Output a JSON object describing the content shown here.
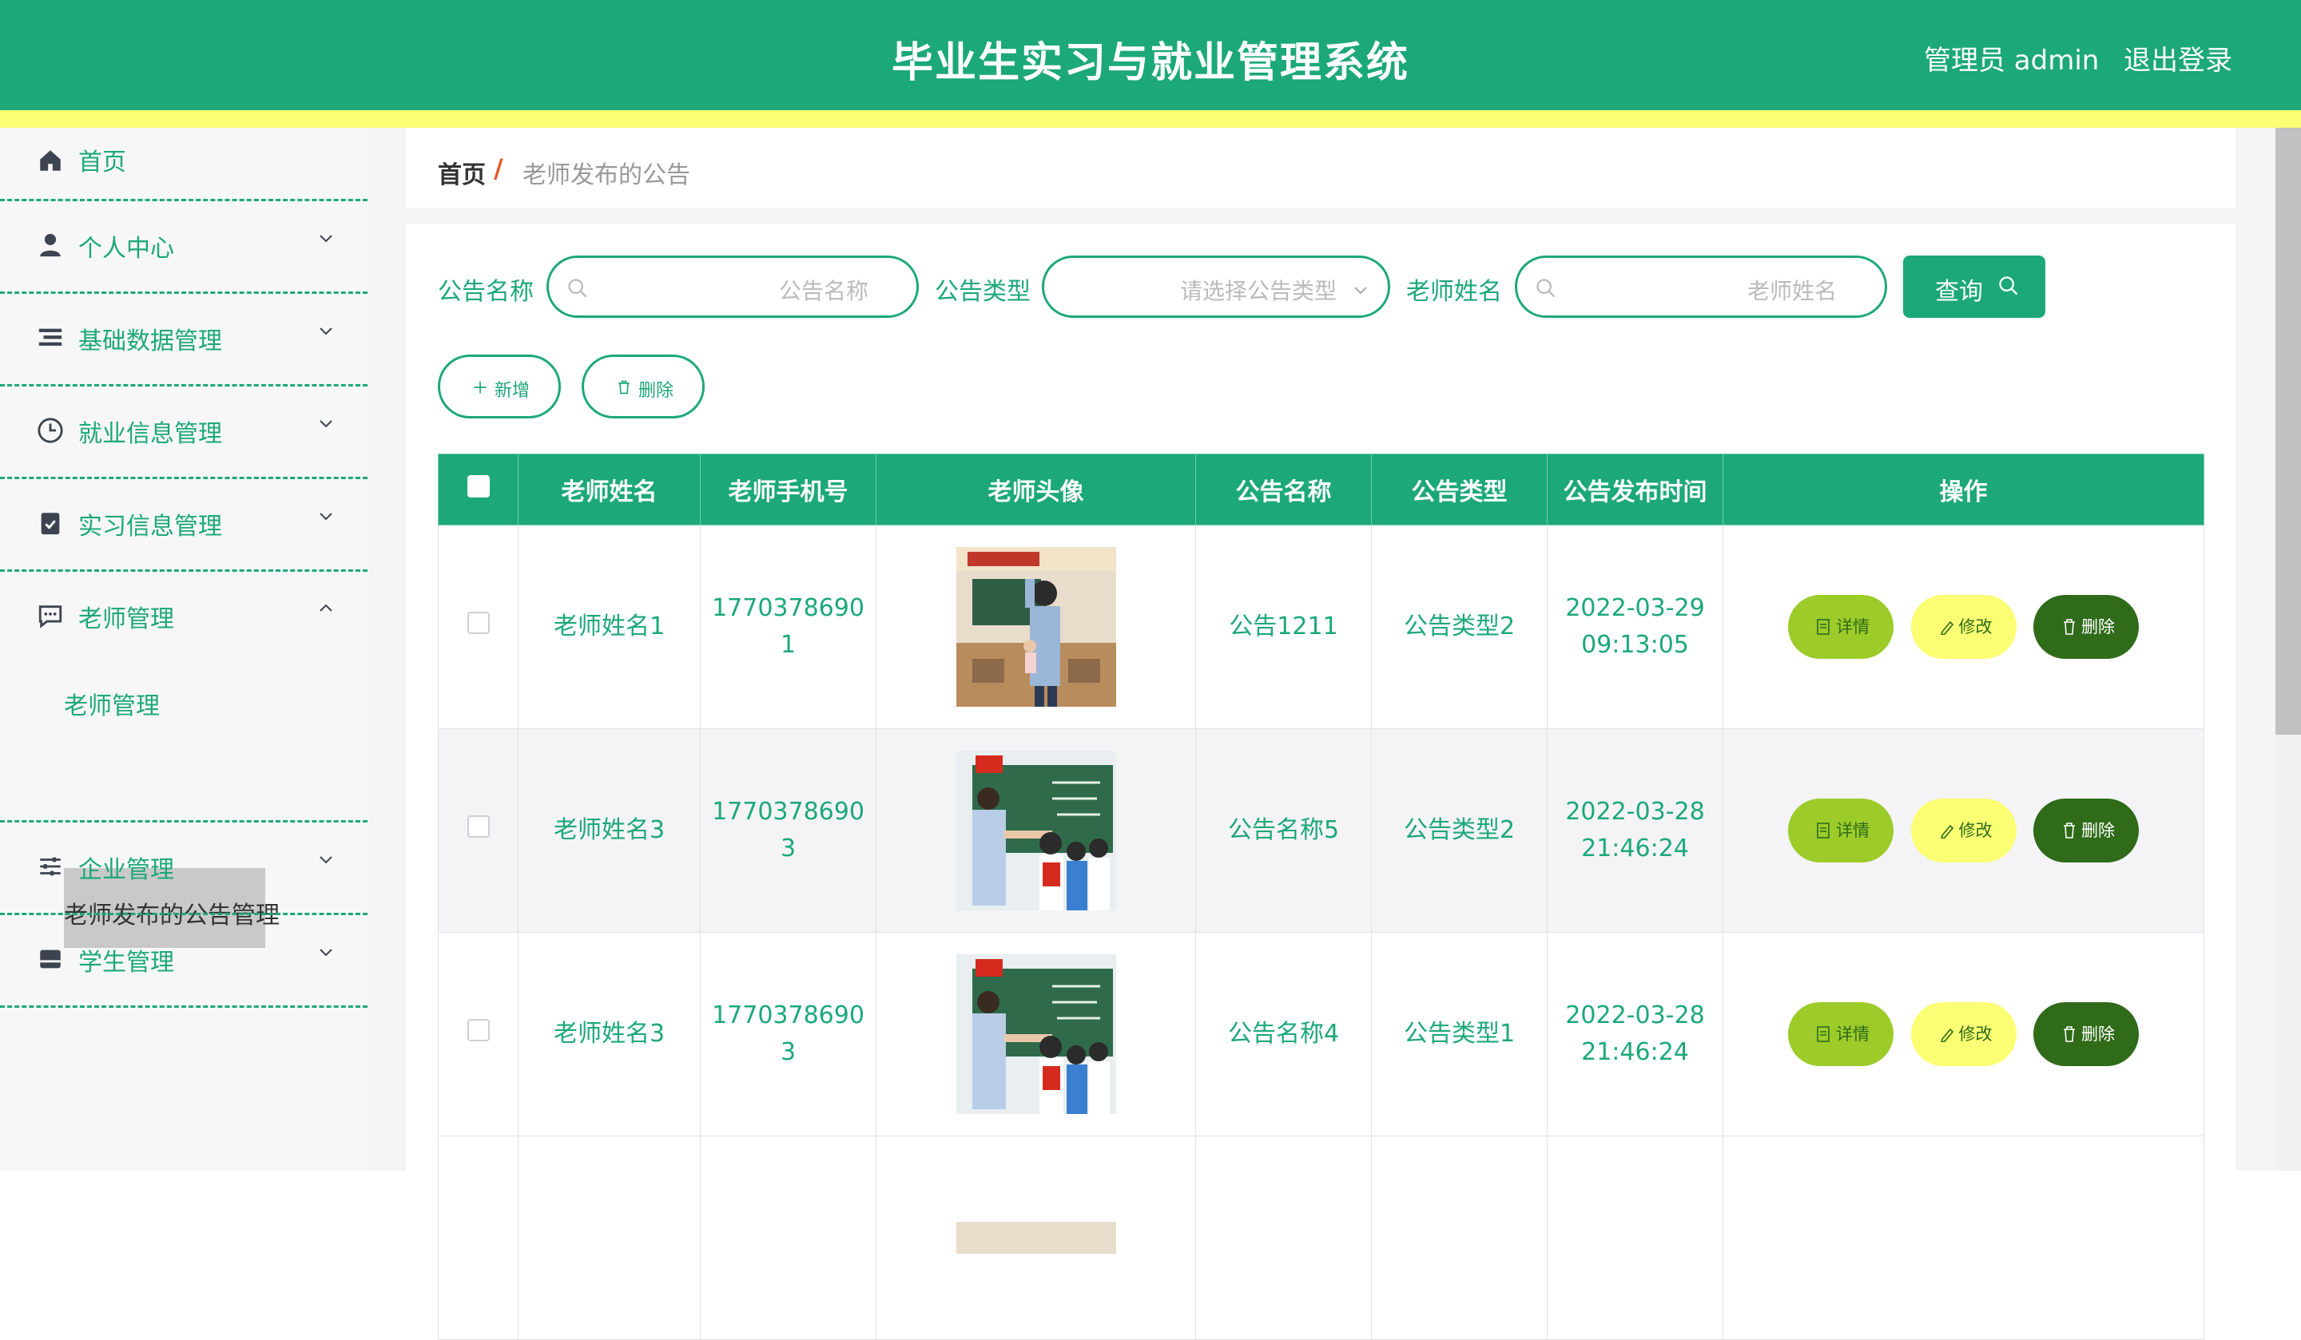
{
  "header": {
    "title": "毕业生实习与就业管理系统",
    "user": "管理员 admin",
    "logout": "退出登录"
  },
  "colors": {
    "primary": "#1ca879",
    "accent_yellow": "#fbff73",
    "detail": "#9ccb2a",
    "danger": "#2f6b19"
  },
  "sidebar": {
    "items": [
      {
        "label": "首页",
        "icon": "home-icon"
      },
      {
        "label": "个人中心",
        "icon": "user-icon"
      },
      {
        "label": "基础数据管理",
        "icon": "list-icon"
      },
      {
        "label": "就业信息管理",
        "icon": "clock-icon"
      },
      {
        "label": "实习信息管理",
        "icon": "clipboard-check-icon"
      },
      {
        "label": "老师管理",
        "icon": "chat-icon"
      },
      {
        "label": "企业管理",
        "icon": "sliders-icon"
      },
      {
        "label": "学生管理",
        "icon": "inbox-icon"
      }
    ],
    "submenu": [
      "老师管理",
      "老师发布的公告管理"
    ]
  },
  "breadcrumb": {
    "home": "首页",
    "separator": "/",
    "current": "老师发布的公告"
  },
  "filters": {
    "name_label": "公告名称",
    "name_placeholder": "公告名称",
    "type_label": "公告类型",
    "type_placeholder": "请选择公告类型",
    "teacher_label": "老师姓名",
    "teacher_placeholder": "老师姓名",
    "query": "查询"
  },
  "actions": {
    "add": "新增",
    "delete": "删除"
  },
  "table": {
    "columns": [
      "老师姓名",
      "老师手机号",
      "老师头像",
      "公告名称",
      "公告类型",
      "公告发布时间",
      "操作"
    ],
    "row_buttons": {
      "detail": "详情",
      "edit": "修改",
      "delete": "删除"
    },
    "rows": [
      {
        "teacher": "老师姓名1",
        "phone_a": "1770378690",
        "phone_b": "1",
        "notice": "公告1211",
        "type": "公告类型2",
        "date": "2022-03-29",
        "time": "09:13:05"
      },
      {
        "teacher": "老师姓名3",
        "phone_a": "1770378690",
        "phone_b": "3",
        "notice": "公告名称5",
        "type": "公告类型2",
        "date": "2022-03-28",
        "time": "21:46:24"
      },
      {
        "teacher": "老师姓名3",
        "phone_a": "1770378690",
        "phone_b": "3",
        "notice": "公告名称4",
        "type": "公告类型1",
        "date": "2022-03-28",
        "time": "21:46:24"
      }
    ]
  }
}
